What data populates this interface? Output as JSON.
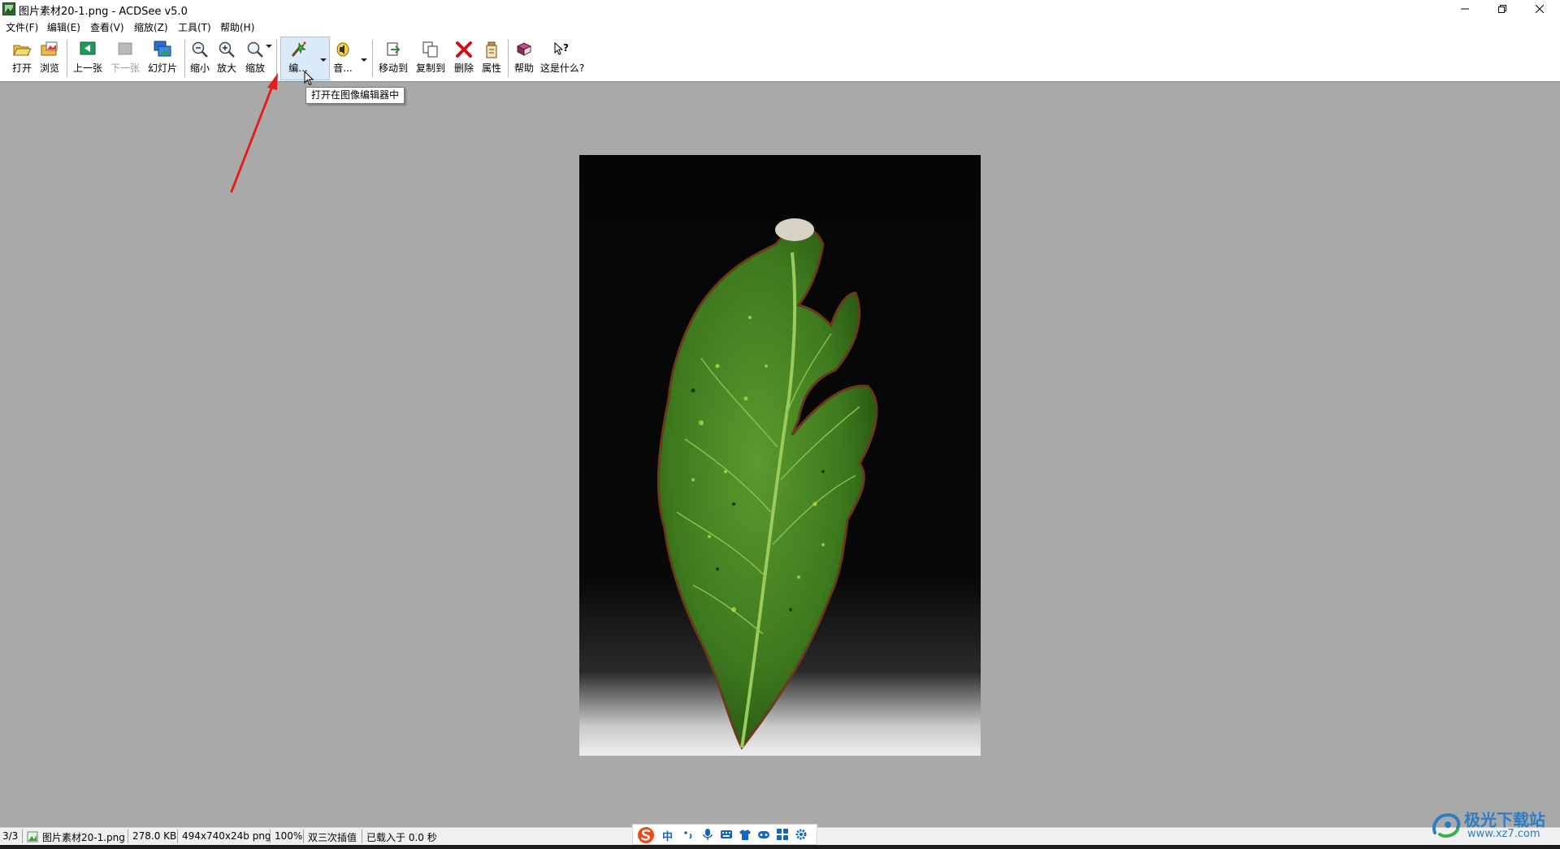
{
  "window": {
    "title": "图片素材20-1.png - ACDSee v5.0"
  },
  "menu": [
    "文件(F)",
    "编辑(E)",
    "查看(V)",
    "缩放(Z)",
    "工具(T)",
    "帮助(H)"
  ],
  "toolbar": {
    "open": "打开",
    "browse": "浏览",
    "prev": "上一张",
    "next": "下一张",
    "slideshow": "幻灯片",
    "zoom_out": "缩小",
    "zoom_in": "放大",
    "zoom": "缩放",
    "edit": "编...",
    "audio": "音...",
    "move_to": "移动到",
    "copy_to": "复制到",
    "delete": "删除",
    "properties": "属性",
    "help": "帮助",
    "whats_this": "这是什么?"
  },
  "tooltip": "打开在图像编辑器中",
  "status": {
    "index": "3/3",
    "filename": "图片素材20-1.png",
    "size": "278.0 KB",
    "dimensions": "494x740x24b png",
    "zoom": "100%",
    "interpolation": "双三次插值",
    "load_time": "已载入于 0.0 秒"
  },
  "ime": {
    "mode": "中"
  },
  "watermark": {
    "brand": "极光下载站",
    "url": "www.xz7.com"
  },
  "colors": {
    "viewer_bg": "#a9a9a9",
    "highlight": "#dbeaf8",
    "annotation_arrow": "#e02020",
    "delete_red": "#d01010"
  }
}
